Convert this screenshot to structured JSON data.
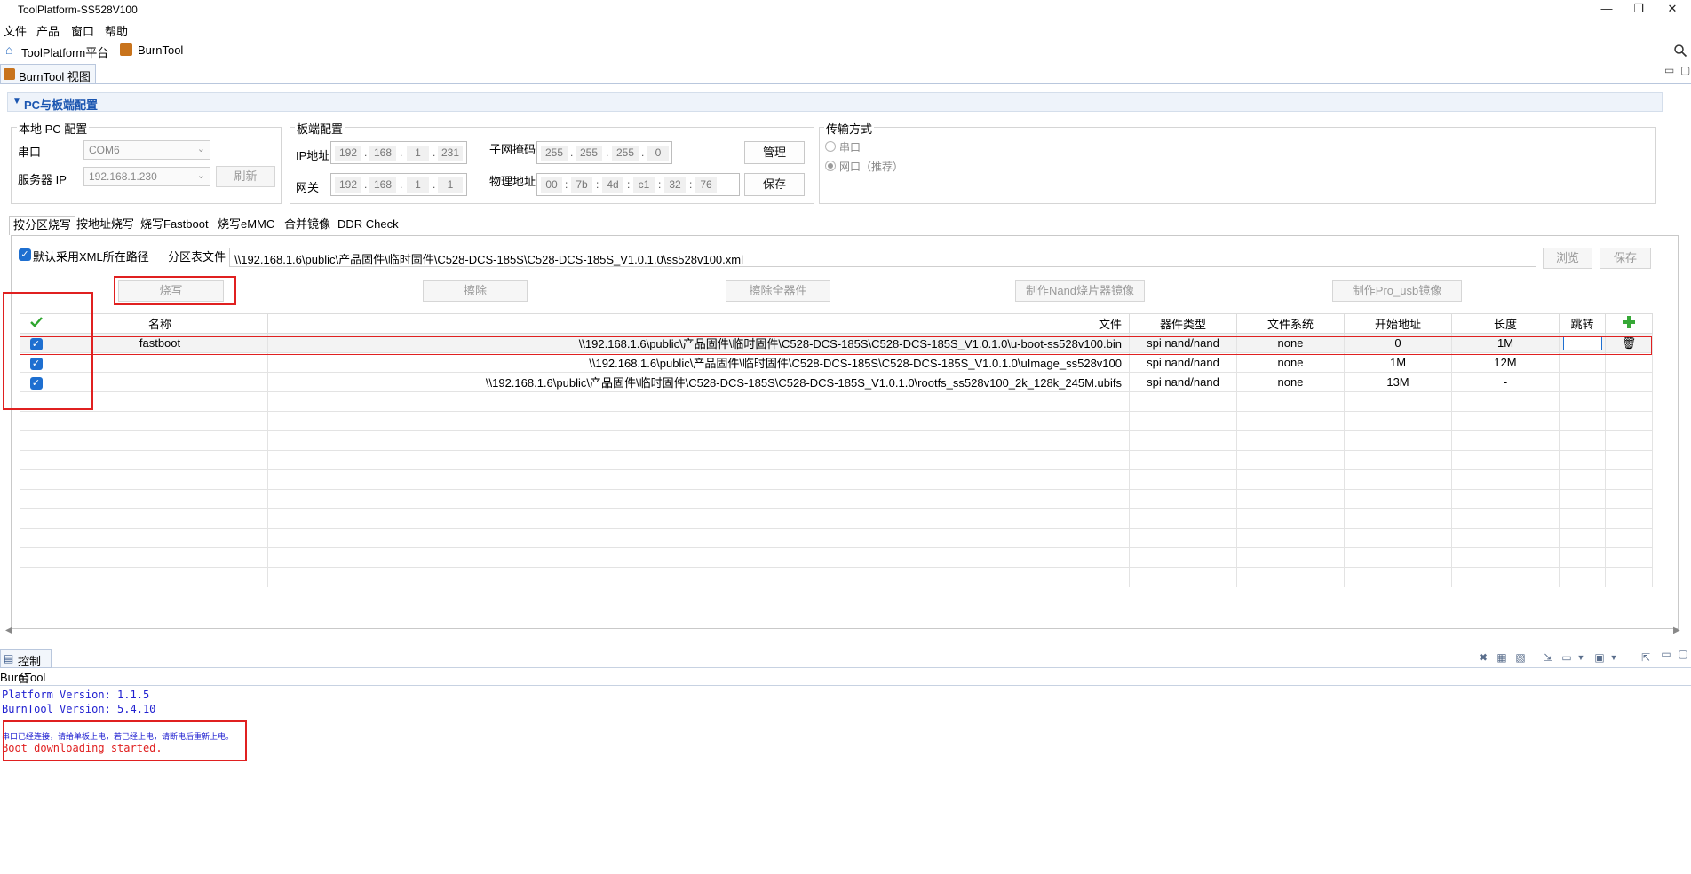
{
  "window": {
    "title": "ToolPlatform-SS528V100",
    "controls": {
      "minimize": "—",
      "maximize": "❐",
      "close": "✕"
    }
  },
  "menu": [
    "文件",
    "产品",
    "窗口",
    "帮助"
  ],
  "toolbar": {
    "platform_label": "ToolPlatform平台",
    "burntool_label": "BurnTool",
    "search_icon": "search-icon"
  },
  "view_tab": {
    "label": "BurnTool 视图"
  },
  "pc_section": {
    "title": "PC与板端配置",
    "local_pc": {
      "title": "本地 PC 配置",
      "serial_label": "串口",
      "serial_value": "COM6",
      "server_ip_label": "服务器 IP",
      "server_ip_value": "192.168.1.230",
      "refresh_label": "刷新"
    },
    "board": {
      "title": "板端配置",
      "ip_label": "IP地址",
      "ip": [
        "192",
        "168",
        "1",
        "231"
      ],
      "gateway_label": "网关",
      "gateway": [
        "192",
        "168",
        "1",
        "1"
      ],
      "mask_label": "子网掩码",
      "mask": [
        "255",
        "255",
        "255",
        "0"
      ],
      "mac_label": "物理地址",
      "mac": [
        "00",
        "7b",
        "4d",
        "c1",
        "32",
        "76"
      ],
      "manage_label": "管理",
      "save_label": "保存"
    },
    "transfer": {
      "title": "传输方式",
      "serial_option": "串口",
      "network_option": "网口（推荐）",
      "selected": "网口（推荐）"
    }
  },
  "tabs": [
    {
      "label": "按分区烧写",
      "active": true
    },
    {
      "label": "按地址烧写",
      "active": false
    },
    {
      "label": "烧写Fastboot",
      "active": false
    },
    {
      "label": "烧写eMMC",
      "active": false
    },
    {
      "label": "合并镜像",
      "active": false
    },
    {
      "label": "DDR Check",
      "active": false
    }
  ],
  "partition": {
    "use_xml_path_label": "默认采用XML所在路径",
    "use_xml_path_checked": true,
    "table_file_label": "分区表文件",
    "table_file_value": "\\\\192.168.1.6\\public\\产品固件\\临时固件\\C528-DCS-185S\\C528-DCS-185S_V1.0.1.0\\ss528v100.xml",
    "browse_label": "浏览",
    "save_label": "保存",
    "actions": {
      "burn": "烧写",
      "erase": "擦除",
      "erase_all": "擦除全器件",
      "make_nand": "制作Nand烧片器镜像",
      "make_pro_usb": "制作Pro_usb镜像"
    },
    "columns": [
      "名称",
      "文件",
      "器件类型",
      "文件系统",
      "开始地址",
      "长度",
      "跳转"
    ],
    "rows": [
      {
        "checked": true,
        "name": "fastboot",
        "file": "\\\\192.168.1.6\\public\\产品固件\\临时固件\\C528-DCS-185S\\C528-DCS-185S_V1.0.1.0\\u-boot-ss528v100.bin",
        "device": "spi nand/nand",
        "fs": "none",
        "start": "0",
        "length": "1M",
        "jump": ""
      },
      {
        "checked": true,
        "name": "",
        "file": "\\\\192.168.1.6\\public\\产品固件\\临时固件\\C528-DCS-185S\\C528-DCS-185S_V1.0.1.0\\uImage_ss528v100",
        "device": "spi nand/nand",
        "fs": "none",
        "start": "1M",
        "length": "12M",
        "jump": ""
      },
      {
        "checked": true,
        "name": "",
        "file": "\\\\192.168.1.6\\public\\产品固件\\临时固件\\C528-DCS-185S\\C528-DCS-185S_V1.0.1.0\\rootfs_ss528v100_2k_128k_245M.ubifs",
        "device": "spi nand/nand",
        "fs": "none",
        "start": "13M",
        "length": "-",
        "jump": ""
      }
    ]
  },
  "console": {
    "tab_label": "控制台",
    "source": "BurnTool",
    "lines": [
      {
        "text": "Platform Version: 1.1.5",
        "color": "#1f1fd0"
      },
      {
        "text": "BurnTool Version: 5.4.10",
        "color": "#1f1fd0"
      },
      {
        "text": "",
        "color": "#1f1fd0"
      },
      {
        "text": "串口已经连接，请给单板上电，若已经上电，请断电后重新上电。",
        "color": "#1f1fd0"
      },
      {
        "text": "Boot downloading started.",
        "color": "#e02020"
      }
    ]
  },
  "colors": {
    "accent": "#1e6fd0",
    "highlight": "#e02020",
    "section_title": "#1a55b0"
  }
}
